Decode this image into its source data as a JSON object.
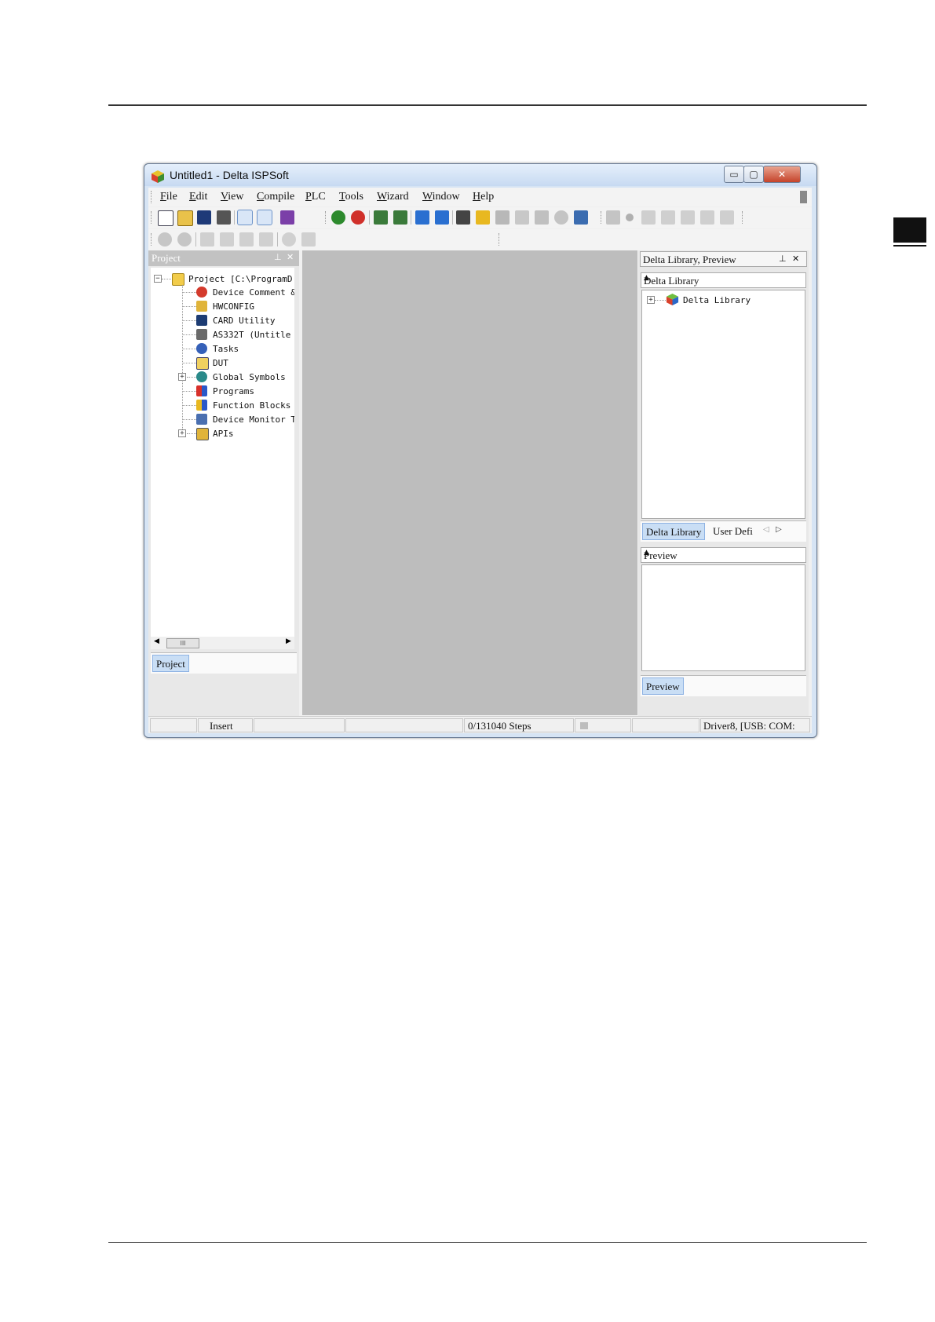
{
  "window": {
    "title": "Untitled1 - Delta ISPSoft",
    "controls": {
      "minimize": "▭",
      "maximize": "▢",
      "close": "✕"
    }
  },
  "menu": [
    "File",
    "Edit",
    "View",
    "Compile",
    "PLC",
    "Tools",
    "Wizard",
    "Window",
    "Help"
  ],
  "project_pane": {
    "title": "Project",
    "pin": "⊥",
    "close": "✕",
    "tree": {
      "root": "Project [C:\\ProgramD",
      "items": [
        "Device Comment &",
        "HWCONFIG",
        "CARD Utility",
        "AS332T   (Untitle",
        "Tasks",
        "DUT",
        "Global Symbols",
        "Programs",
        "Function Blocks",
        "Device Monitor T",
        "APIs"
      ]
    },
    "scroll_thumb": "III",
    "tab": "Project"
  },
  "right_pane": {
    "title": "Delta Library, Preview",
    "pin": "⊥",
    "close": "✕",
    "library_header": "Delta Library",
    "library_tree_item": "Delta Library",
    "tabs": [
      "Delta Library",
      "User Defi"
    ],
    "preview_header": "Preview",
    "preview_tab": "Preview"
  },
  "statusbar": {
    "mode": "Insert",
    "steps": "0/131040 Steps",
    "driver": "Driver8, [USB: COM:"
  },
  "colors": {
    "accent": "#8db2e3",
    "workspace": "#bdbdbd",
    "close_button": "#c5432b"
  }
}
